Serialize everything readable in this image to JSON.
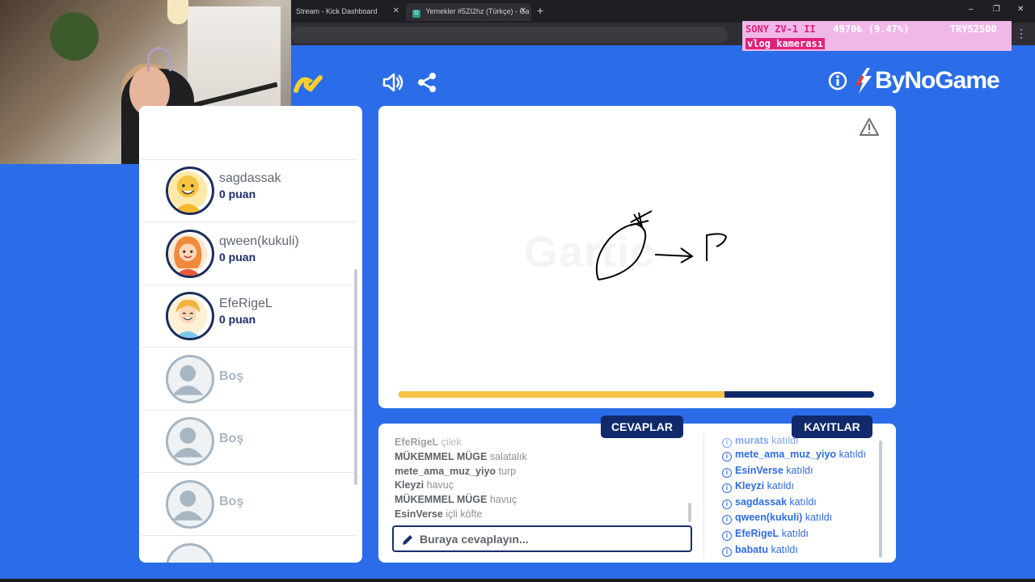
{
  "browser": {
    "tabs": [
      {
        "title": "Stream - Kick Dashboard"
      },
      {
        "title": "Yemekler #5ZI2hz (Türkçe) - Ga"
      }
    ],
    "new_tab": "+",
    "window_controls": [
      "–",
      "❐",
      "✕"
    ]
  },
  "overlay": {
    "ticker_product": "SONY ZV-1 II",
    "ticker_price": "4970₺ (9.47%)",
    "ticker_currency": "TRY52500",
    "ticker_sub": "vlog kamerası"
  },
  "header": {
    "brand": "ByNoGame",
    "icons": [
      "sound-icon",
      "share-icon",
      "info-icon"
    ]
  },
  "players": [
    {
      "name": "sagdassak",
      "points": "0 puan",
      "avatar": "#f5c542"
    },
    {
      "name": "qween(kukuli)",
      "points": "0 puan",
      "avatar": "#f08a3c"
    },
    {
      "name": "EfeRigeL",
      "points": "0 puan",
      "avatar": "#f3b33d"
    },
    {
      "name": "Boş"
    },
    {
      "name": "Boş"
    },
    {
      "name": "Boş"
    }
  ],
  "canvas": {
    "watermark": "Gartic",
    "timer_progress": 0.686
  },
  "chat": {
    "answers_label": "CEVAPLAR",
    "logs_label": "KAYITLAR",
    "answers": [
      {
        "user": "EfeRigeL",
        "text": "çilek"
      },
      {
        "user": "MÜKEMMEL MÜGE",
        "text": "salatalık"
      },
      {
        "user": "mete_ama_muz_yiyo",
        "text": "turp"
      },
      {
        "user": "Kleyzi",
        "text": "havuç"
      },
      {
        "user": "MÜKEMMEL MÜGE",
        "text": "havuç"
      },
      {
        "user": "EsinVerse",
        "text": "içli köfte"
      }
    ],
    "input_placeholder": "Buraya cevaplayın...",
    "logs": [
      {
        "user": "murats",
        "text": "katıldı"
      },
      {
        "user": "mete_ama_muz_yiyo",
        "text": "katıldı"
      },
      {
        "user": "EsinVerse",
        "text": "katıldı"
      },
      {
        "user": "Kleyzi",
        "text": "katıldı"
      },
      {
        "user": "sagdassak",
        "text": "katıldı"
      },
      {
        "user": "qween(kukuli)",
        "text": "katıldı"
      },
      {
        "user": "EfeRigeL",
        "text": "katıldı"
      },
      {
        "user": "babatu",
        "text": "katıldı"
      }
    ]
  },
  "colors": {
    "background": "#2b6de8",
    "navy": "#112a6b",
    "timer_fill": "#f4c244",
    "log_blue": "#2f6be0"
  }
}
